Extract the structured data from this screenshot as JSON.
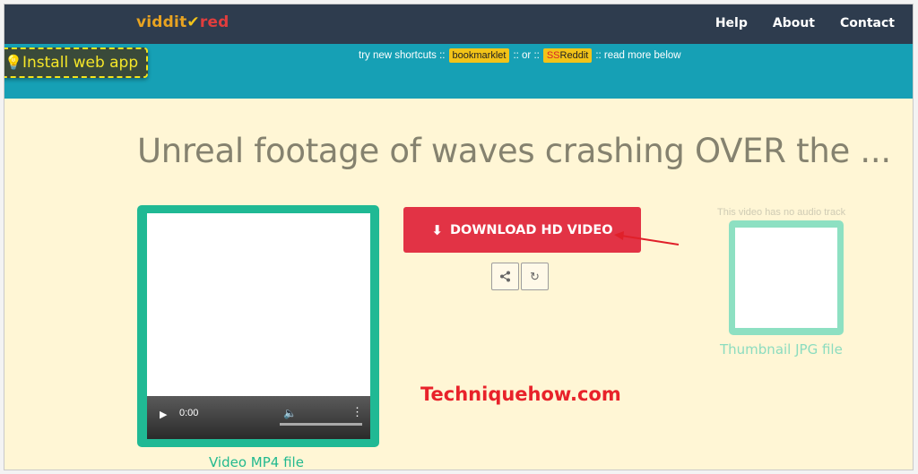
{
  "logo": {
    "part1": "viddit",
    "part2": "✔",
    "part3": "red"
  },
  "nav": {
    "help": "Help",
    "about": "About",
    "contact": "Contact"
  },
  "install": {
    "label": "Install web app",
    "icon": "lightbulb-icon"
  },
  "shortcuts": {
    "prefix": "try new shortcuts ::",
    "bookmarklet": "bookmarklet",
    "or": ":: or ::",
    "ssreddit_ss": "SS",
    "ssreddit_rest": "Reddit",
    "suffix": ":: read more below"
  },
  "title": "Unreal footage of waves crashing OVER the ...",
  "video": {
    "time": "0:00",
    "label": "Video MP4 file"
  },
  "download": {
    "label": "DOWNLOAD HD VIDEO",
    "icon": "download-icon"
  },
  "thumbnail": {
    "note": "This video has no audio track",
    "label": "Thumbnail JPG file"
  },
  "watermark": "Techniquehow.com",
  "colors": {
    "header": "#2e3c4e",
    "teal": "#16a0b5",
    "background": "#fff6d5",
    "download": "#e23345",
    "video_frame": "#20b994",
    "thumb_frame": "#8de0c2"
  }
}
